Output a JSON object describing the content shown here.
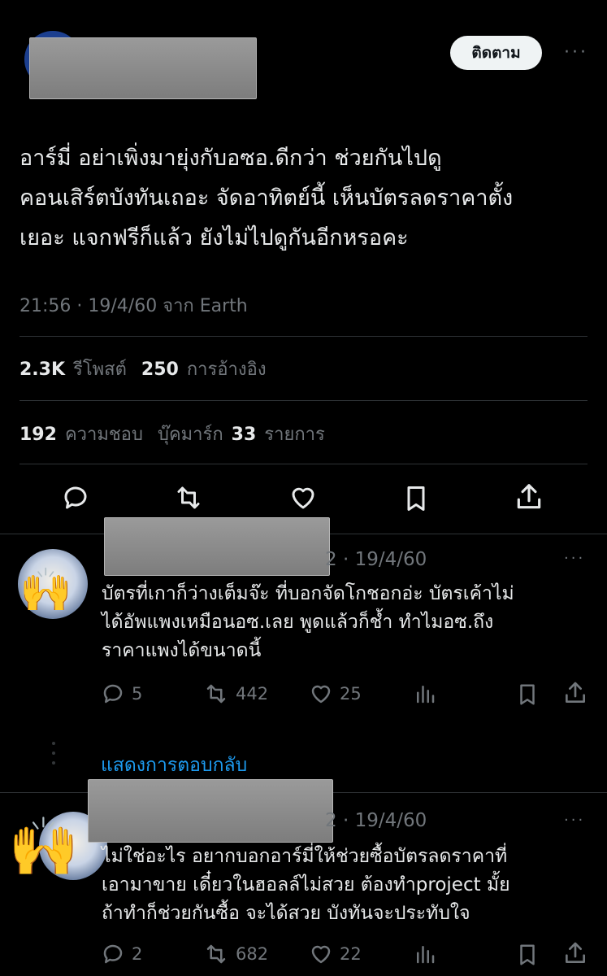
{
  "header": {
    "follow_label": "ติดตาม",
    "more_label": "···"
  },
  "tweet": {
    "lines": [
      "อาร์มี่ อย่าเพิ่งมายุ่งกับอซอ.ดีกว่า ช่วยกันไปดู",
      "คอนเสิร์ตบังทันเถอะ จัดอาทิตย์นี้ เห็นบัตรลดราคาตั้ง",
      "เยอะ แจกฟรีก็แล้ว ยังไม่ไปดูกันอีกหรอคะ"
    ],
    "meta": "21:56 · 19/4/60 จาก Earth",
    "retweets_count": "2.3K",
    "retweets_label": "รีโพสต์",
    "quotes_count": "250",
    "quotes_label": "การอ้างอิง",
    "likes_count": "192",
    "likes_label": "ความชอบ",
    "bookmarks_label": "บุ๊คมาร์ก",
    "bookmarks_count": "33",
    "bookmarks_suffix": "รายการ"
  },
  "replies": [
    {
      "date": "2 · 19/4/60",
      "lines": [
        "บัตรที่เกาก็ว่างเต็มจ๊ะ ที่บอกจัดโกชอกอ่ะ บัตรเค้าไม่",
        "ได้อัพแพงเหมือนอซ.เลย พูดแล้วก็ช้ำ ทำไมอซ.ถึง",
        "ราคาแพงได้ขนาดนี้"
      ],
      "replies": "5",
      "retweets": "442",
      "likes": "25",
      "avatar_emoji": "🙌"
    },
    {
      "date": "2 · 19/4/60",
      "lines": [
        "ไม่ใช่อะไร อยากบอกอาร์มี่ให้ช่วยซื้อบัตรลดราคาที่",
        "เอามาขาย เดี๋ยวในฮอลล์ไม่สวย ต้องทำproject มั้ย",
        "ถ้าทำก็ช่วยกันซื้อ จะได้สวย บังทันจะประทับใจ"
      ],
      "replies": "2",
      "retweets": "682",
      "likes": "22",
      "avatar_emoji": "🙌"
    }
  ],
  "show_replies_label": "แสดงการตอบกลับ",
  "colors": {
    "link": "#1d9bf0",
    "muted": "#71767b",
    "divider": "#2f3336"
  }
}
